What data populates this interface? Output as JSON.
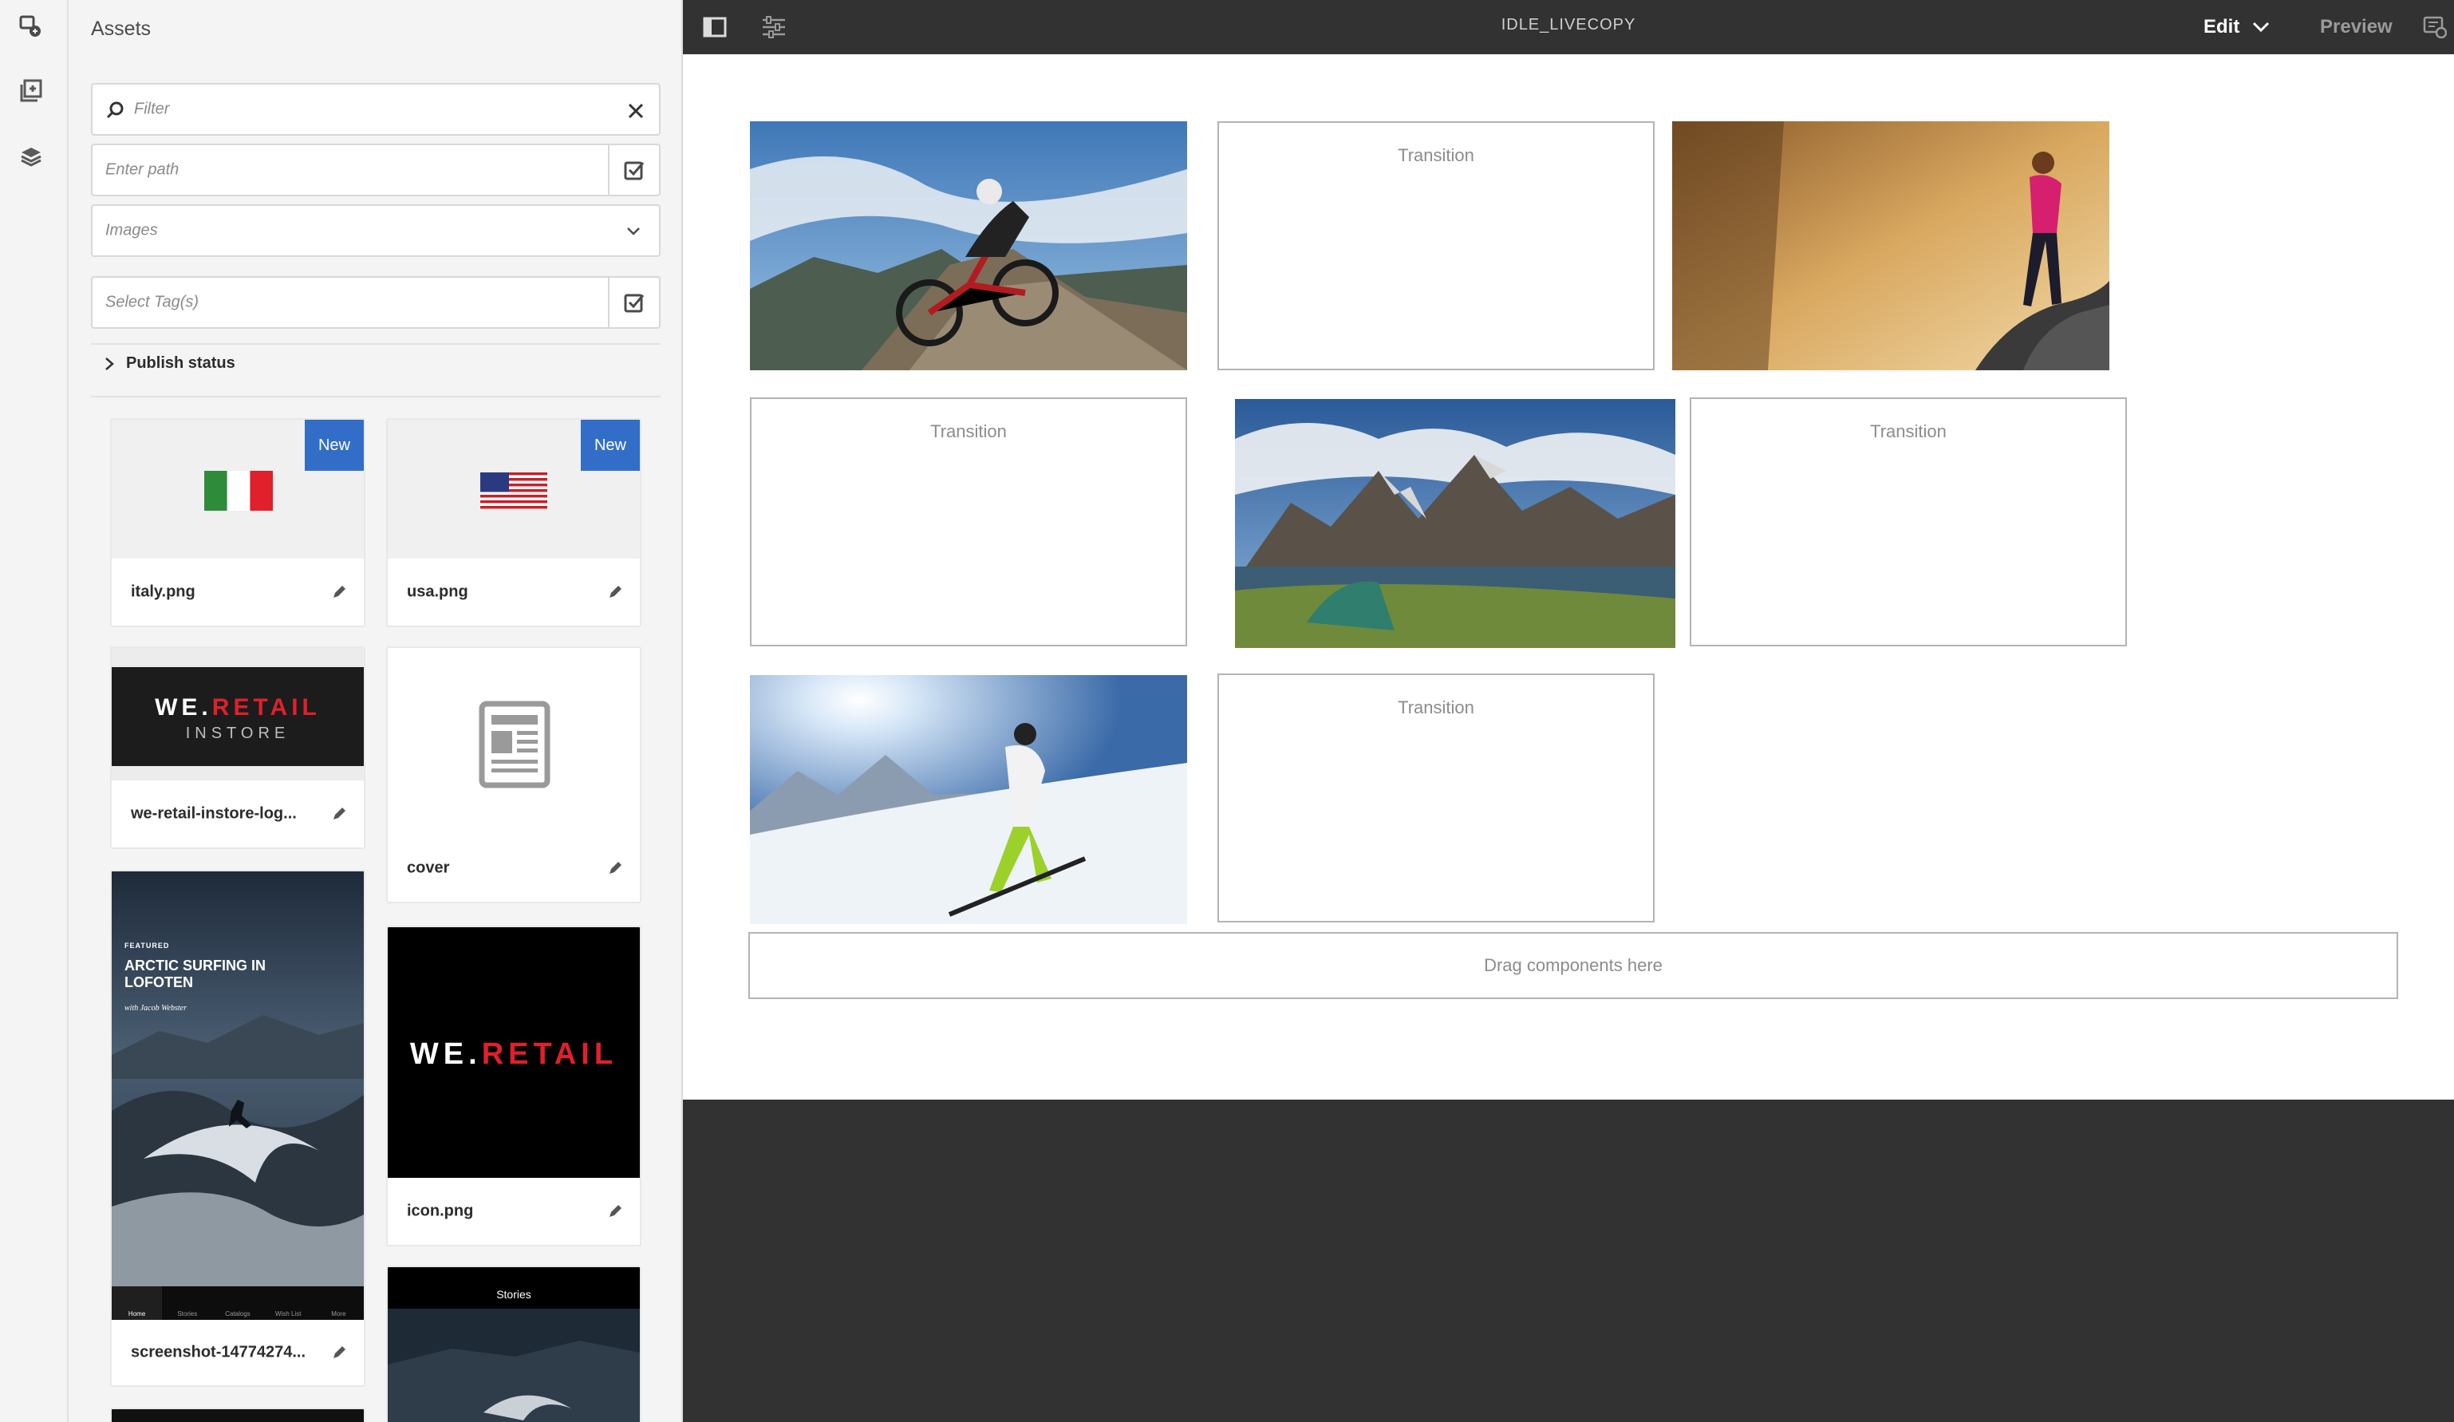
{
  "app": {
    "page_title": "IDLE_LIVECOPY",
    "mode_label": "Edit",
    "preview_label": "Preview"
  },
  "panel": {
    "title": "Assets",
    "filter_placeholder": "Filter",
    "path_placeholder": "Enter path",
    "type_value": "Images",
    "tags_placeholder": "Select Tag(s)",
    "publish_status_label": "Publish status"
  },
  "assets": [
    {
      "name": "italy.png",
      "badge": "New",
      "thumb": "italy-flag"
    },
    {
      "name": "usa.png",
      "badge": "New",
      "thumb": "usa-flag"
    },
    {
      "name": "we-retail-instore-log...",
      "thumb": "we-retail-instore-logo"
    },
    {
      "name": "cover",
      "thumb": "document-icon"
    },
    {
      "name": "screenshot-14774274...",
      "thumb": "arctic-surfing-screenshot"
    },
    {
      "name": "icon.png",
      "thumb": "we-retail-logo"
    }
  ],
  "asset_thumb_text": {
    "instore_brand": "WE.",
    "instore_brand_red": "RETAIL",
    "instore_sub": "INSTORE",
    "surf_featured": "FEATURED",
    "surf_title": "ARCTIC SURFING IN LOFOTEN",
    "surf_byline": "with Jacob Webster",
    "surf_tabs": [
      "Home",
      "Stories",
      "Catalogs",
      "Wish List",
      "More"
    ],
    "icon_brand": "WE.",
    "icon_brand_red": "RETAIL",
    "stories_header": "Stories"
  },
  "canvas": {
    "cells": [
      {
        "kind": "image",
        "subject": "mountain-biker"
      },
      {
        "kind": "placeholder",
        "label": "Transition"
      },
      {
        "kind": "image",
        "subject": "woman-running"
      },
      {
        "kind": "placeholder",
        "label": "Transition"
      },
      {
        "kind": "image",
        "subject": "tent-in-mountains"
      },
      {
        "kind": "placeholder",
        "label": "Transition"
      },
      {
        "kind": "image",
        "subject": "skier"
      },
      {
        "kind": "placeholder",
        "label": "Transition"
      }
    ],
    "dropzone_label": "Drag components here"
  },
  "colors": {
    "topbar": "#323232",
    "panel": "#f4f4f4",
    "badge": "#326ec8",
    "brand_red": "#e0202a"
  },
  "icons": {
    "rail": [
      "assets-icon",
      "components-icon",
      "content-tree-icon"
    ],
    "topbar": [
      "toggle-side-panel-icon",
      "page-properties-icon",
      "annotations-icon"
    ]
  }
}
